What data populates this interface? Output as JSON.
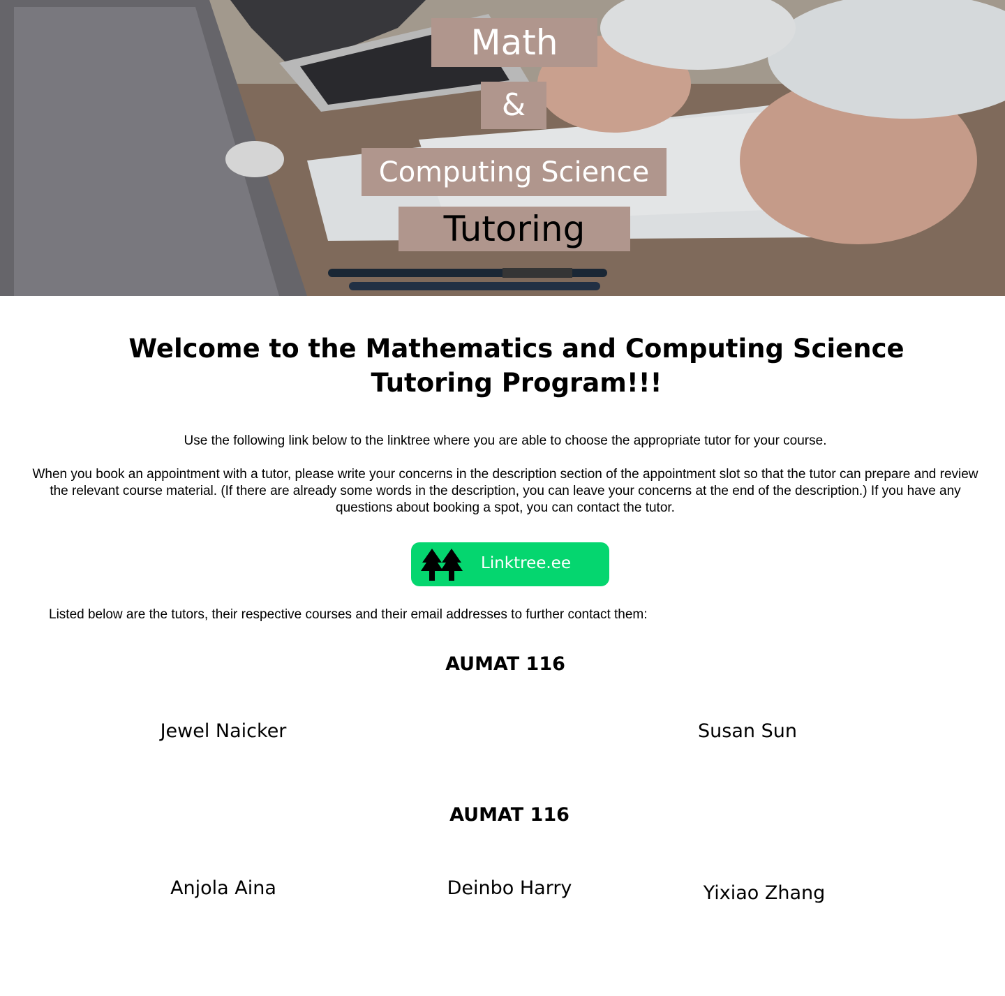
{
  "hero": {
    "title_line1": "Math",
    "title_line2": "&",
    "title_line3": "Computing Science",
    "title_line4": "Tutoring"
  },
  "intro": {
    "heading": "Welcome to the Mathematics and Computing Science Tutoring Program!!!",
    "paragraph1": "Use the following link below to the linktree where you are able to choose the appropriate tutor for your course.",
    "paragraph2": "When you book an appointment with a tutor, please write your concerns in the description section of the appointment slot so that the tutor can prepare and review the relevant course material. (If there are already some words in the description, you can leave your concerns at the end of the description.) If you have any questions about booking a spot, you can contact the tutor."
  },
  "linktree": {
    "label": "Linktree.ee",
    "color": "#05d66f",
    "icon": "linktree-icon"
  },
  "tutors_intro": "Listed below are the tutors, their respective courses and their email addresses to further contact them:",
  "sections": [
    {
      "course": "AUMAT 116",
      "tutors": [
        "Jewel Naicker",
        "Susan Sun"
      ]
    },
    {
      "course": "AUMAT 116",
      "tutors": [
        "Anjola Aina",
        "Deinbo Harry",
        "Yixiao Zhang"
      ]
    }
  ],
  "colors": {
    "tag_background": "#b0968d",
    "button_green": "#05d66f"
  }
}
